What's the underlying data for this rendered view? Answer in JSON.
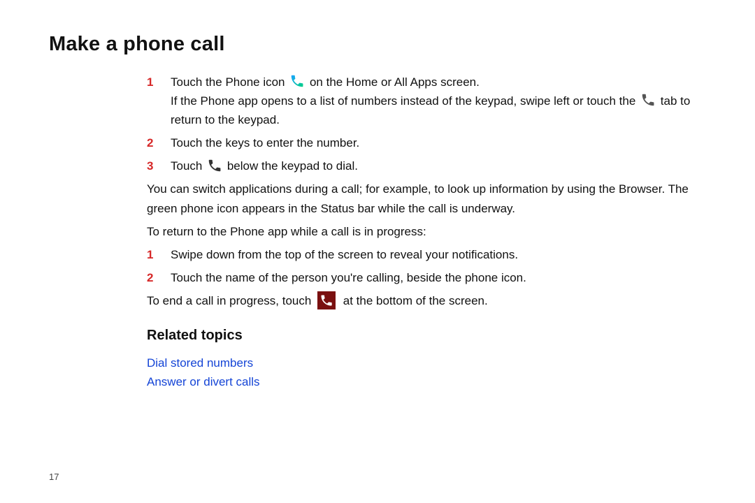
{
  "title": "Make a phone call",
  "stepsA": [
    {
      "num": "1",
      "pre": "Touch the Phone icon ",
      "post": " on the Home or All Apps screen.",
      "extra_pre": "If the Phone app opens to a list of numbers instead of the keypad, swipe left or touch the ",
      "extra_post": " tab to return to the keypad."
    },
    {
      "num": "2",
      "text": "Touch the keys to enter the number."
    },
    {
      "num": "3",
      "pre": "Touch ",
      "post": " below the keypad to dial."
    }
  ],
  "para_switch": "You can switch applications during a call; for example, to look up information by using the Browser. The green phone icon appears in the Status bar while the call is underway.",
  "para_return_intro": "To return to the Phone app while a call is in progress:",
  "stepsB": [
    {
      "num": "1",
      "text": "Swipe down from the top of the screen to reveal your notifications."
    },
    {
      "num": "2",
      "text": "Touch the name of the person you're calling, beside the phone icon."
    }
  ],
  "para_end_pre": "To end a call in progress, touch ",
  "para_end_post": " at the bottom of the screen.",
  "related_heading": "Related topics",
  "related_links": [
    "Dial stored numbers",
    "Answer or divert calls"
  ],
  "page_number": "17"
}
